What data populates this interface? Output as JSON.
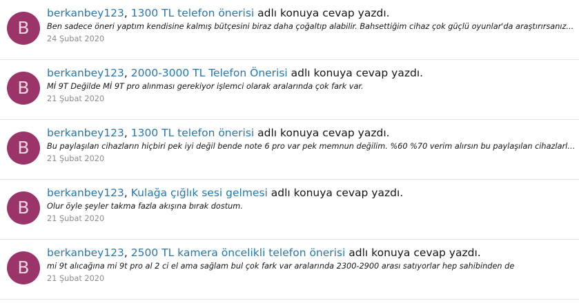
{
  "activity": [
    {
      "avatar_letter": "B",
      "user": "berkanbey123",
      "separator": ", ",
      "thread": "1300 TL telefon önerisi",
      "action": " adlı konuya cevap yazdı.",
      "snippet": "Ben sadece öneri yaptım kendisine kalmış bütçesini biraz daha çoğaltıp alabilir. Bahsettiğim cihaz çok güçlü oyunlar'da araştırırsanız...",
      "date": "24 Şubat 2020"
    },
    {
      "avatar_letter": "B",
      "user": "berkanbey123",
      "separator": ", ",
      "thread": "2000-3000 TL Telefon Önerisi",
      "action": " adlı konuya cevap yazdı.",
      "snippet": "Mİ 9T Değilde Mİ 9T pro alınması gerekiyor işlemci olarak aralarında çok fark var.",
      "date": "21 Şubat 2020"
    },
    {
      "avatar_letter": "B",
      "user": "berkanbey123",
      "separator": ", ",
      "thread": "1300 TL telefon önerisi",
      "action": " adlı konuya cevap yazdı.",
      "snippet": "Bu paylaşılan cihazların hiçbiri pek iyi değil bende note 6 pro var pek memnun değilim. %60 %70 verim alırsın bu paylaşılan cihazlarla...",
      "date": "21 Şubat 2020"
    },
    {
      "avatar_letter": "B",
      "user": "berkanbey123",
      "separator": ", ",
      "thread": "Kulağa çığlık sesi gelmesi",
      "action": " adlı konuya cevap yazdı.",
      "snippet": "Olur öyle şeyler takma fazla akışına bırak dostum.",
      "date": "21 Şubat 2020"
    },
    {
      "avatar_letter": "B",
      "user": "berkanbey123",
      "separator": ", ",
      "thread": "2500 TL kamera öncelikli telefon önerisi",
      "action": " adlı konuya cevap yazdı.",
      "snippet": "mi 9t alıcağına mi 9t pro al 2 ci el ama sağlam bul çok fark var aralarında 2300-2900 arası satıyorlar hep sahibinden de",
      "date": "21 Şubat 2020"
    }
  ],
  "colors": {
    "link": "#2577b1",
    "avatar_bg": "#9b3468",
    "date": "#8c8c8c"
  }
}
